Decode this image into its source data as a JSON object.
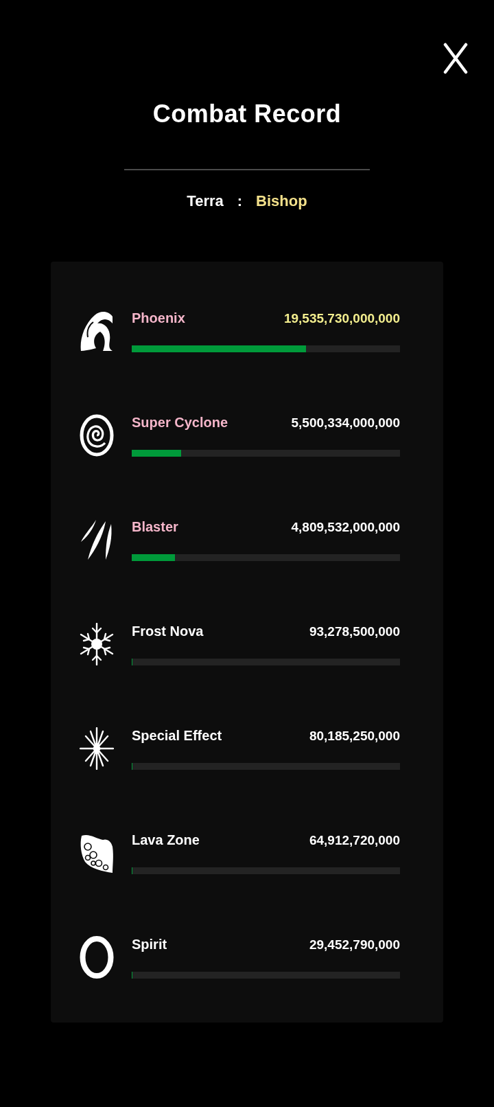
{
  "header": {
    "title": "Combat Record",
    "subtitle": {
      "label": "Terra",
      "separator": ":",
      "value": "Bishop"
    }
  },
  "skills": [
    {
      "name": "Phoenix",
      "value": "19,535,730,000,000",
      "level": 0.649,
      "kind": "first"
    },
    {
      "name": "Super Cyclone",
      "value": "5,500,334,000,000",
      "level": 0.183,
      "kind": "top"
    },
    {
      "name": "Blaster",
      "value": "4,809,532,000,000",
      "level": 0.16,
      "kind": "top"
    },
    {
      "name": "Frost Nova",
      "value": "93,278,500,000",
      "level": 0.003,
      "kind": "normal"
    },
    {
      "name": "Special Effect",
      "value": "80,185,250,000",
      "level": 0.003,
      "kind": "normal"
    },
    {
      "name": "Lava Zone",
      "value": "64,912,720,000",
      "level": 0.002,
      "kind": "normal"
    },
    {
      "name": "Spirit",
      "value": "29,452,790,000",
      "level": 0.001,
      "kind": "normal"
    }
  ]
}
